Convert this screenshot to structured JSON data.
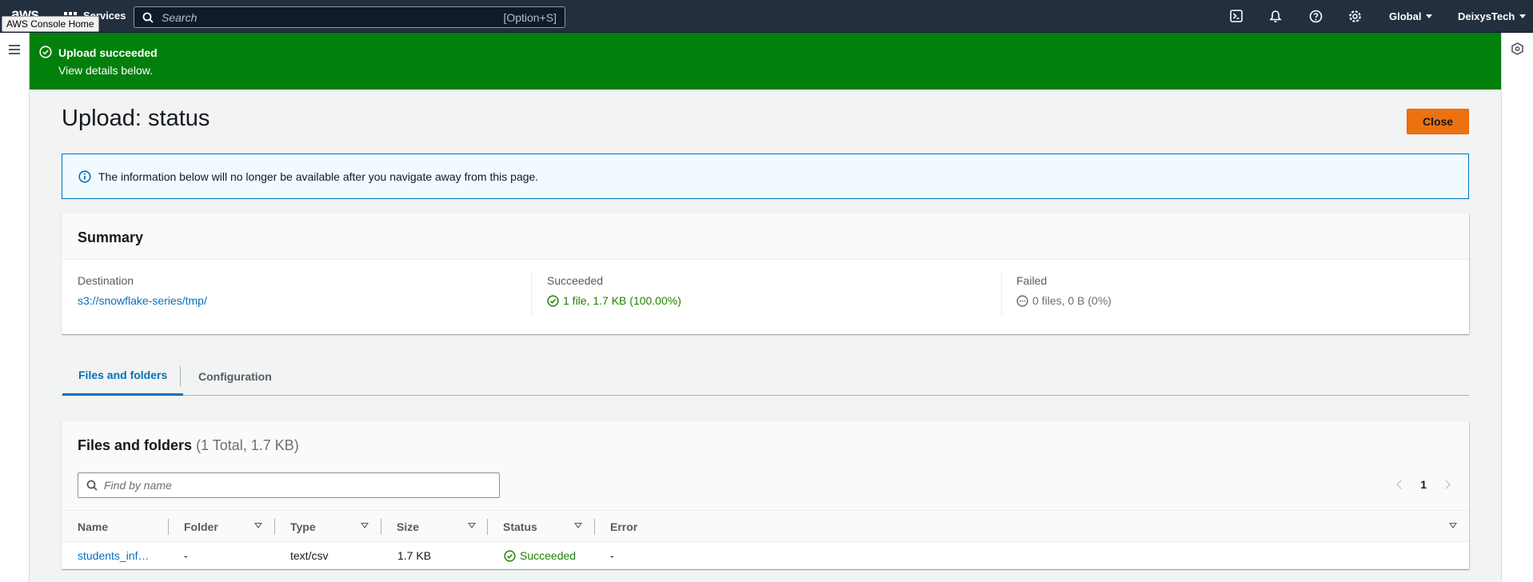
{
  "topnav": {
    "logo": "aws",
    "tooltip": "AWS Console Home",
    "services_label": "Services",
    "search_placeholder": "Search",
    "search_shortcut": "[Option+S]",
    "region": "Global",
    "account": "DeixysTech",
    "icons": [
      "cloudshell-icon",
      "bell-icon",
      "help-icon",
      "gear-icon"
    ]
  },
  "flash": {
    "title": "Upload succeeded",
    "description": "View details below.",
    "color": "#037f0c"
  },
  "page": {
    "title": "Upload: status",
    "close_label": "Close"
  },
  "info": {
    "text": "The information below will no longer be available after you navigate away from this page."
  },
  "summary": {
    "title": "Summary",
    "destination_label": "Destination",
    "destination_value": "s3://snowflake-series/tmp/",
    "succeeded_label": "Succeeded",
    "succeeded_value": "1 file, 1.7 KB (100.00%)",
    "failed_label": "Failed",
    "failed_value": "0 files, 0 B (0%)"
  },
  "tabs": [
    {
      "label": "Files and folders",
      "active": true
    },
    {
      "label": "Configuration",
      "active": false
    }
  ],
  "files": {
    "title": "Files and folders",
    "count": "(1 Total, 1.7 KB)",
    "find_placeholder": "Find by name",
    "page": "1",
    "columns": [
      "Name",
      "Folder",
      "Type",
      "Size",
      "Status",
      "Error"
    ],
    "rows": [
      {
        "name": "students_inf…",
        "folder": "-",
        "type": "text/csv",
        "size": "1.7 KB",
        "status": "Succeeded",
        "error": "-"
      }
    ]
  }
}
